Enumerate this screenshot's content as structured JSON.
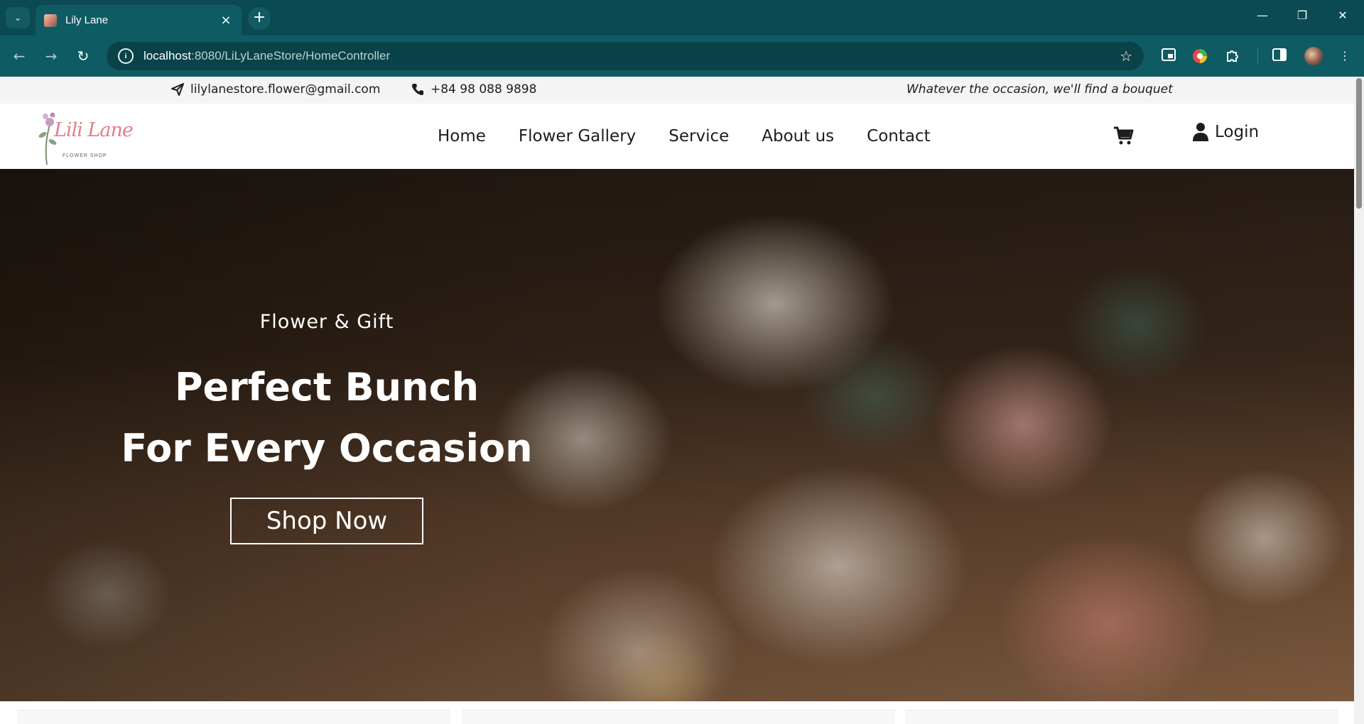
{
  "browser": {
    "tab": {
      "title": "Lily Lane",
      "close_icon": "close-icon",
      "favicon": "flower-favicon"
    },
    "new_tab_icon": "plus-icon",
    "tab_search_icon": "chevron-down-icon",
    "window_controls": {
      "minimize": "—",
      "restore": "❐",
      "close": "✕"
    },
    "nav": {
      "back": "←",
      "forward": "→",
      "reload": "↻"
    },
    "url": {
      "host": "localhost",
      "path": ":8080/LiLyLaneStore/HomeController"
    },
    "site_info_icon": "info-icon",
    "bookmark_icon": "star-icon",
    "extension_icons": [
      "picture-in-picture-icon",
      "color-picker-icon",
      "puzzle-icon",
      "side-panel-icon"
    ],
    "profile_icon": "avatar-icon",
    "menu_icon": "more-vert-icon"
  },
  "topbar": {
    "email_icon": "paper-plane-icon",
    "email": "lilylanestore.flower@gmail.com",
    "phone_icon": "phone-icon",
    "phone": "+84 98 088 9898",
    "tagline": "Whatever the occasion, we'll find a bouquet"
  },
  "header": {
    "logo": {
      "script": "Lili Lane",
      "sub": "FLOWER SHOP"
    },
    "menu": [
      "Home",
      "Flower Gallery",
      "Service",
      "About us",
      "Contact"
    ],
    "cart_icon": "cart-icon",
    "login_icon": "user-icon",
    "login_label": "Login"
  },
  "hero": {
    "kicker": "Flower & Gift",
    "title_line1": "Perfect Bunch",
    "title_line2": "For Every Occasion",
    "cta": "Shop Now"
  },
  "colors": {
    "chrome_dark": "#0b4a52",
    "chrome_mid": "#0e5b64",
    "logo_pink": "#e0808a",
    "text_dark": "#1d1d1d"
  }
}
